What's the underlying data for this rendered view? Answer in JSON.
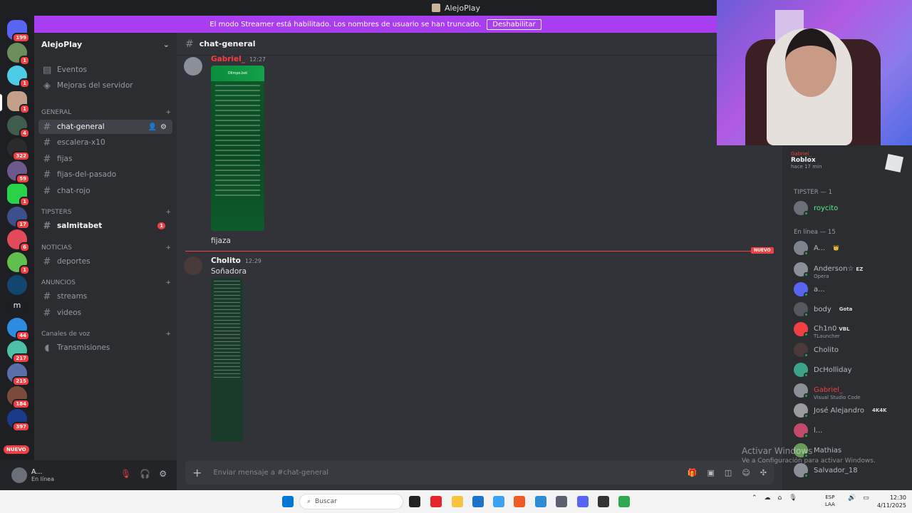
{
  "window": {
    "title": "AlejoPlay"
  },
  "banner": {
    "text": "El modo Streamer está habilitado. Los nombres de usuario se han truncado.",
    "button": "Deshabilitar"
  },
  "rail": {
    "badges": [
      "199",
      "1",
      "1",
      "1",
      "4",
      "322",
      "59",
      "1",
      "17",
      "6",
      "1",
      "44",
      "217",
      "215",
      "184",
      "397"
    ],
    "letter_server": "m",
    "nuevo": "NUEVO"
  },
  "server": {
    "name": "AlejoPlay"
  },
  "sidebar": {
    "top": [
      {
        "label": "Eventos"
      },
      {
        "label": "Mejoras del servidor"
      }
    ],
    "categories": {
      "general": "GENERAL",
      "tipsters": "TIPSTERS",
      "noticias": "NOTICIAS",
      "anuncios": "ANUNCIOS",
      "voz": "Canales de voz"
    },
    "channels": {
      "general": [
        "chat-general",
        "escalera-x10",
        "fijas",
        "fijas-del-pasado",
        "chat-rojo"
      ],
      "tipsters": [
        "salmitabet"
      ],
      "noticias": [
        "deportes"
      ],
      "anuncios": [
        "streams",
        "videos"
      ],
      "voz": [
        "Transmisiones"
      ]
    },
    "salmitabet_badge": "1"
  },
  "user": {
    "name": "A...",
    "status": "En línea"
  },
  "chat": {
    "channel": "chat-general",
    "messages": [
      {
        "author": "Gabriel_",
        "time": "12:27",
        "text": "fijaza",
        "image_title": "Olimpo.bet"
      },
      {
        "author": "Cholito",
        "time": "12:29",
        "text": "Soñadora"
      }
    ],
    "new_label": "NUEVO",
    "placeholder": "Enviar mensaje a #chat-general"
  },
  "activity": {
    "user": "Gabriel_",
    "game": "Roblox",
    "ago": "hace 17 min"
  },
  "members": {
    "tipster_heading": "TIPSTER — 1",
    "online_heading": "En línea — 15",
    "tipster": [
      {
        "name": "roycito"
      }
    ],
    "online": [
      {
        "name": "A...",
        "activity": "",
        "tag": "👑"
      },
      {
        "name": "Anderson☆",
        "activity": "Opera",
        "tag": "EZ"
      },
      {
        "name": "a...",
        "activity": "",
        "tag": ""
      },
      {
        "name": "body",
        "activity": "",
        "tag": "Gota"
      },
      {
        "name": "Ch1n0",
        "activity": "TLauncher",
        "tag": "VBL"
      },
      {
        "name": "Cholito",
        "activity": "",
        "tag": ""
      },
      {
        "name": "DcHolliday",
        "activity": "",
        "tag": ""
      },
      {
        "name": "Gabriel_",
        "activity": "Visual Studio Code",
        "tag": ""
      },
      {
        "name": "José Alejandro",
        "activity": "",
        "tag": "4K4K"
      },
      {
        "name": "l...",
        "activity": "",
        "tag": ""
      },
      {
        "name": "Mathias",
        "activity": "",
        "tag": ""
      },
      {
        "name": "Salvador_18",
        "activity": "",
        "tag": ""
      }
    ]
  },
  "watermark": {
    "title": "Activar Windows",
    "subtitle": "Ve a Configuración para activar Windows."
  },
  "taskbar": {
    "search": "Buscar",
    "lang": "ESP",
    "lang2": "LAA",
    "time": "12:30",
    "date": "4/11/2025"
  },
  "colors": {
    "accent": "#a83ef0",
    "danger": "#f23f43",
    "online": "#23a55a"
  }
}
